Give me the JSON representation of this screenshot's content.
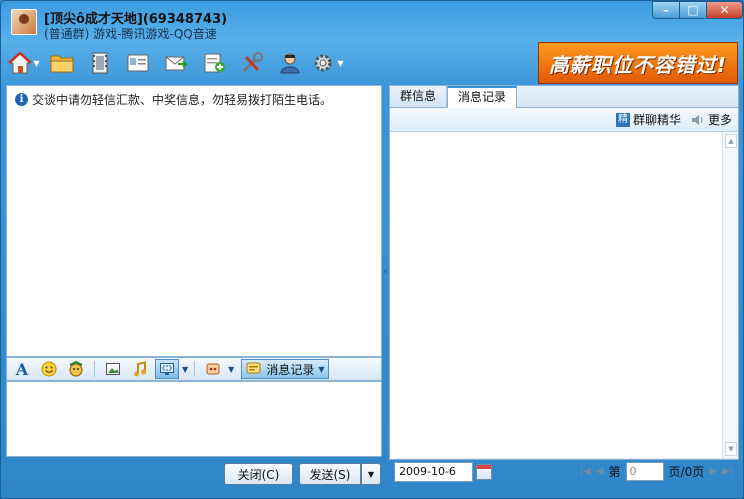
{
  "window": {
    "title": "[顶尖ô成才天地](69348743)",
    "subtitle": "(普通群) 游戏-腾讯游戏-QQ音速",
    "controls": {
      "minimize": "–",
      "maximize": "□",
      "close": "✕"
    }
  },
  "toolbar": {
    "items": [
      {
        "icon": "home-icon",
        "has_dropdown": true
      },
      {
        "icon": "folder-icon",
        "has_dropdown": false
      },
      {
        "icon": "film-icon",
        "has_dropdown": false
      },
      {
        "icon": "card-icon",
        "has_dropdown": false
      },
      {
        "icon": "mail-icon",
        "has_dropdown": false
      },
      {
        "icon": "add-note-icon",
        "has_dropdown": false
      },
      {
        "icon": "tools-icon",
        "has_dropdown": false
      },
      {
        "icon": "user-badge-icon",
        "has_dropdown": false
      },
      {
        "icon": "gear-icon",
        "has_dropdown": true
      }
    ]
  },
  "ad": {
    "text": "高薪职位不容错过!"
  },
  "chat": {
    "notice": "交谈中请勿轻信汇款、中奖信息，勿轻易拨打陌生电话。"
  },
  "format_bar": {
    "message_record_label": "消息记录"
  },
  "buttons": {
    "close_label": "关闭(C)",
    "send_label": "发送(S)"
  },
  "right_pane": {
    "tabs": [
      {
        "label": "群信息",
        "active": false
      },
      {
        "label": "消息记录",
        "active": true
      }
    ],
    "sub_bar": {
      "essence_label": "群聊精华",
      "essence_icon_char": "精",
      "more_label": "更多"
    },
    "date_value": "2009-10-6",
    "pager": {
      "page_prefix": "第",
      "page_value": "0",
      "page_suffix": "页/0页"
    }
  },
  "colors": {
    "title_bar": "#3c9be0",
    "ad_background": "#e05a05",
    "active_tab_border": "#3b91d6"
  }
}
